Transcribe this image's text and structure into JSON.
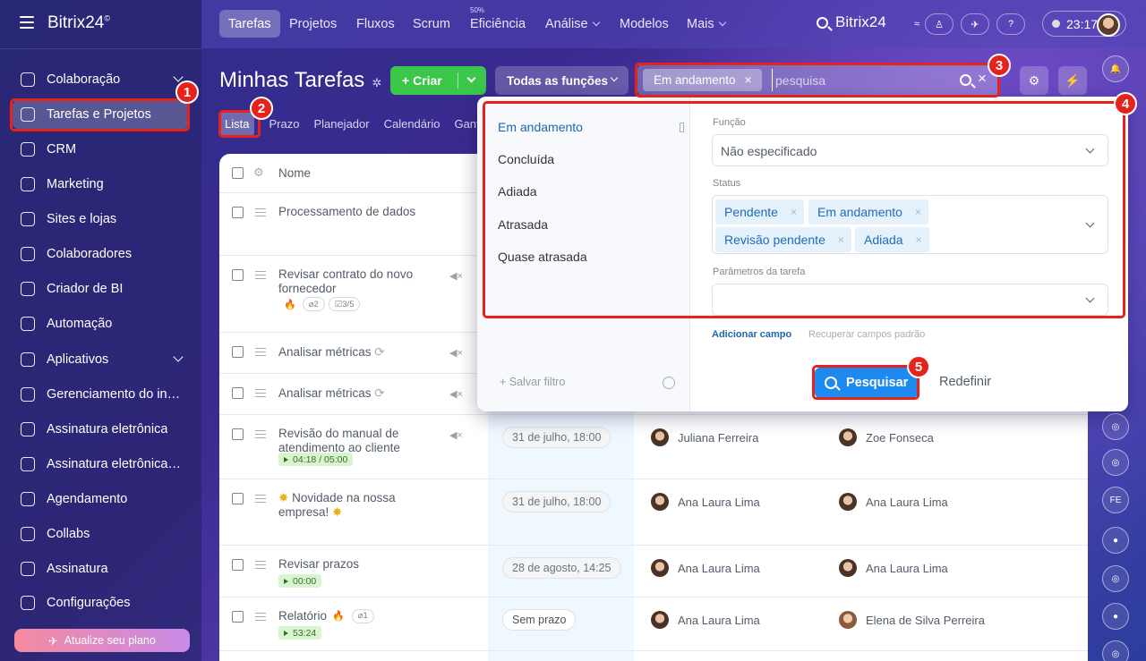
{
  "brand": {
    "logo": "Bitrix24",
    "logo_mark": "©"
  },
  "sidebar": {
    "items": [
      {
        "label": "Colaboração",
        "icon": "collab-icon",
        "chevron": true
      },
      {
        "label": "Tarefas e Projetos",
        "icon": "tasks-icon",
        "active": true
      },
      {
        "label": "CRM",
        "icon": "crm-icon"
      },
      {
        "label": "Marketing",
        "icon": "marketing-icon"
      },
      {
        "label": "Sites e lojas",
        "icon": "cart-icon"
      },
      {
        "label": "Colaboradores",
        "icon": "employees-icon"
      },
      {
        "label": "Criador de BI",
        "icon": "bi-icon"
      },
      {
        "label": "Automação",
        "icon": "robot-icon"
      },
      {
        "label": "Aplicativos",
        "icon": "apps-icon",
        "chevron": true
      },
      {
        "label": "Gerenciamento do inv...",
        "icon": "inventory-icon"
      },
      {
        "label": "Assinatura eletrônica",
        "icon": "sign-icon"
      },
      {
        "label": "Assinatura eletrônica ...",
        "icon": "sign-doc-icon"
      },
      {
        "label": "Agendamento",
        "icon": "calendar-icon"
      },
      {
        "label": "Collabs",
        "icon": "collabs-icon"
      },
      {
        "label": "Assinatura",
        "icon": "subscription-icon"
      },
      {
        "label": "Configurações",
        "icon": "settings-icon"
      }
    ],
    "upgrade_label": "Atualize seu plano"
  },
  "topnav": {
    "items": [
      "Tarefas",
      "Projetos",
      "Fluxos",
      "Scrum",
      "Eficiência",
      "Análise",
      "Modelos",
      "Mais"
    ],
    "efficiency_small": "50%",
    "search_label": "Bitrix24",
    "clock": "23:17"
  },
  "header": {
    "title": "Minhas Tarefas",
    "create_label": "+ Criar",
    "roles_label": "Todas as funções",
    "active_filter_chip": "Em andamento",
    "search_placeholder": "pesquisa"
  },
  "view_tabs": [
    "Lista",
    "Prazo",
    "Planejador",
    "Calendário",
    "Gant"
  ],
  "table": {
    "name_header": "Nome",
    "rows": [
      {
        "name": "Processamento de dados"
      },
      {
        "name": "Revisar contrato do novo fornecedor",
        "muted": true,
        "files": "2",
        "checklist": "3/5"
      },
      {
        "name": "Analisar métricas",
        "repeat": true,
        "muted": true
      },
      {
        "name": "Analisar métricas",
        "repeat": true,
        "muted": true
      },
      {
        "name": "Revisão do manual de atendimento ao cliente",
        "muted": true,
        "timer": "04:18 / 05:00",
        "deadline": "31 de julho, 18:00",
        "creator": "Juliana Ferreira",
        "responsible": "Zoe Fonseca"
      },
      {
        "name": "Novidade na nossa empresa!",
        "deadline": "31 de julho, 18:00",
        "creator": "Ana Laura Lima",
        "responsible": "Ana Laura Lima"
      },
      {
        "name": "Revisar prazos",
        "timer": "00:00",
        "deadline": "28 de agosto, 14:25",
        "creator": "Ana Laura Lima",
        "responsible": "Ana Laura Lima"
      },
      {
        "name": "Relatório",
        "files": "1",
        "timer": "53:24",
        "deadline": "Sem prazo",
        "creator": "Ana Laura Lima",
        "responsible": "Elena de Silva Perreira"
      }
    ]
  },
  "filter_popup": {
    "presets": [
      "Em andamento",
      "Concluída",
      "Adiada",
      "Atrasada",
      "Quase atrasada"
    ],
    "save_filter": "+ Salvar filtro",
    "role_label": "Função",
    "role_value": "Não especificado",
    "status_label": "Status",
    "status_tags": [
      "Pendente",
      "Em andamento",
      "Revisão pendente",
      "Adiada"
    ],
    "params_label": "Parâmetros da tarefa",
    "add_field": "Adicionar campo",
    "restore_fields": "Recuperar campos padrão",
    "search_button": "Pesquisar",
    "reset_button": "Redefinir"
  },
  "annotations": [
    "1",
    "2",
    "3",
    "4",
    "5"
  ],
  "colors": {
    "accent_red": "#e5231b",
    "create_green": "#3bc74a",
    "search_blue": "#1e8af0"
  }
}
